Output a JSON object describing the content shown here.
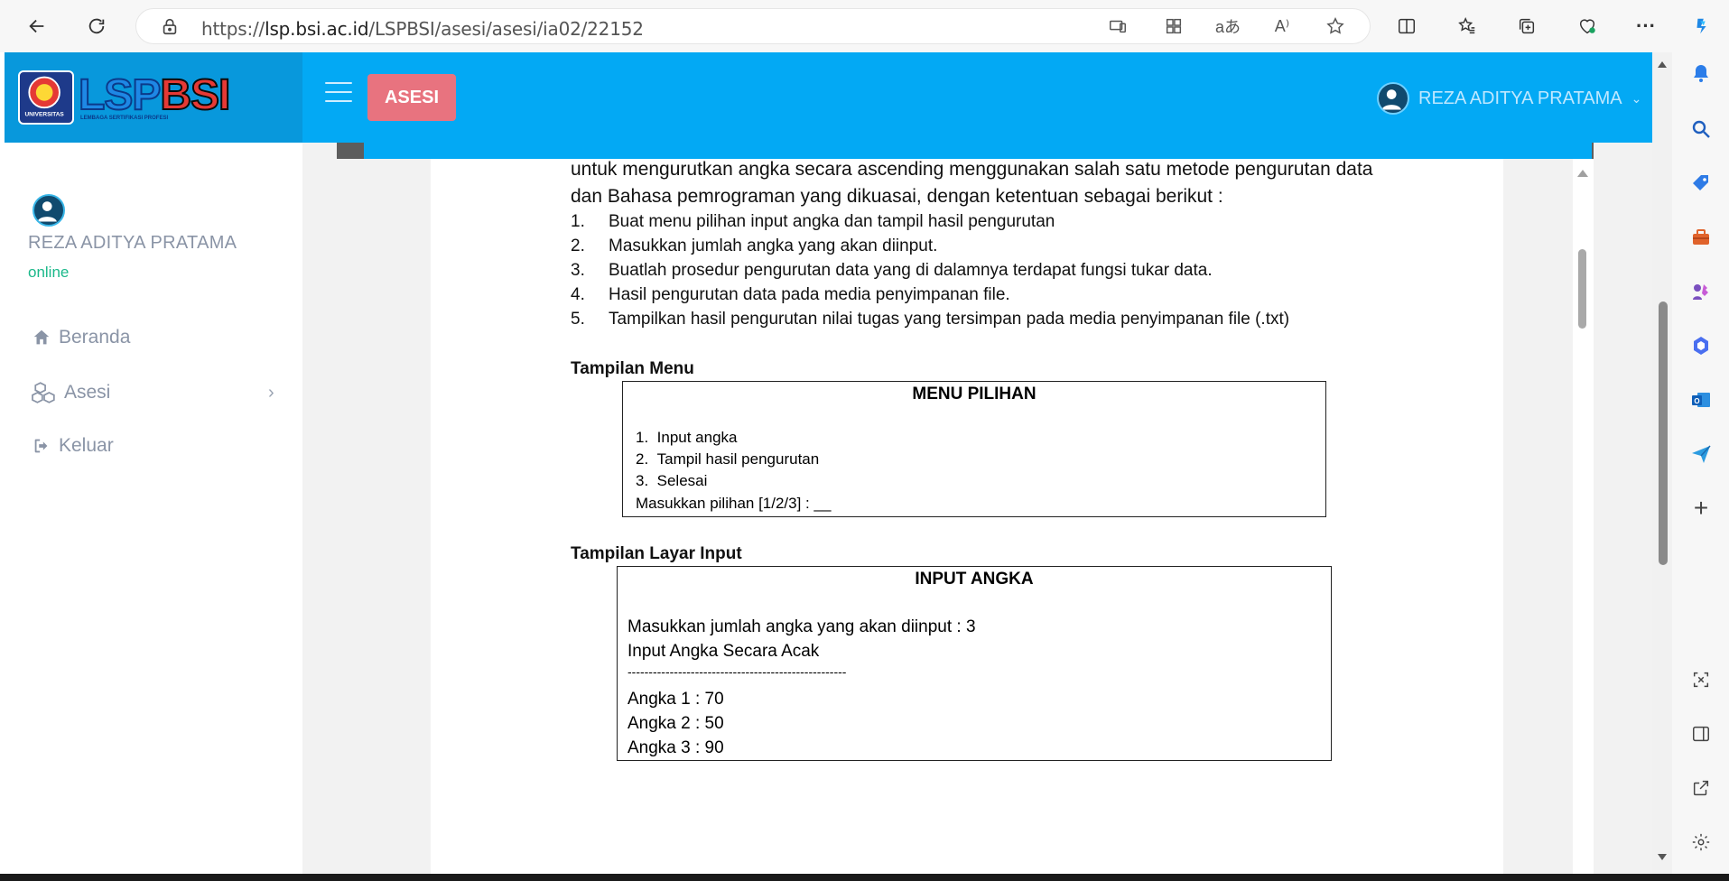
{
  "browser": {
    "url_prefix": "https://",
    "url_host": "lsp.bsi.ac.id",
    "url_path": "/LSPBSI/asesi/asesi/ia02/22152"
  },
  "header": {
    "logo_lsp": "LSP",
    "logo_bsi": "BSI",
    "logo_sub": "LEMBAGA SERTIFIKASI PROFESI",
    "logo_badge_text": "UNIVERSITAS",
    "role_chip": "ASESI",
    "user_name": "REZA ADITYA PRATAMA"
  },
  "sidebar": {
    "user_name": "REZA ADITYA PRATAMA",
    "status": "online",
    "items": [
      {
        "label": "Beranda",
        "icon": "home-icon"
      },
      {
        "label": "Asesi",
        "icon": "cubes-icon"
      },
      {
        "label": "Keluar",
        "icon": "sign-out-icon"
      }
    ]
  },
  "document": {
    "intro_line1": "untuk mengurutkan angka secara ascending menggunakan salah satu metode pengurutan data",
    "intro_line2": "dan Bahasa pemrograman yang dikuasai, dengan ketentuan sebagai berikut :",
    "list": [
      {
        "num": "1.",
        "text": "Buat menu pilihan input angka dan tampil hasil pengurutan"
      },
      {
        "num": "2.",
        "text": "Masukkan jumlah angka yang akan diinput."
      },
      {
        "num": "3.",
        "text": "Buatlah prosedur pengurutan data yang di dalamnya terdapat fungsi tukar data."
      },
      {
        "num": "4.",
        "text": "Hasil pengurutan data pada media penyimpanan file."
      },
      {
        "num": "5.",
        "text": "Tampilkan hasil pengurutan nilai tugas yang tersimpan pada media penyimpanan file (.txt)"
      }
    ],
    "menu_section_title": "Tampilan Menu",
    "menu_box": {
      "title": "MENU PILIHAN",
      "options": [
        {
          "num": "1.",
          "text": "Input angka"
        },
        {
          "num": "2.",
          "text": "Tampil hasil pengurutan"
        },
        {
          "num": "3.",
          "text": "Selesai"
        }
      ],
      "prompt": "Masukkan pilihan [1/2/3] : __"
    },
    "input_section_title": "Tampilan Layar Input",
    "input_box": {
      "title": "INPUT ANGKA",
      "line1": "Masukkan jumlah angka yang akan diinput : 3",
      "line2": "Input Angka Secara Acak",
      "separator": "----------------------------------------------------",
      "entries": [
        "Angka  1 : 70",
        "Angka  2 : 50",
        "Angka  3 : 90"
      ]
    }
  }
}
